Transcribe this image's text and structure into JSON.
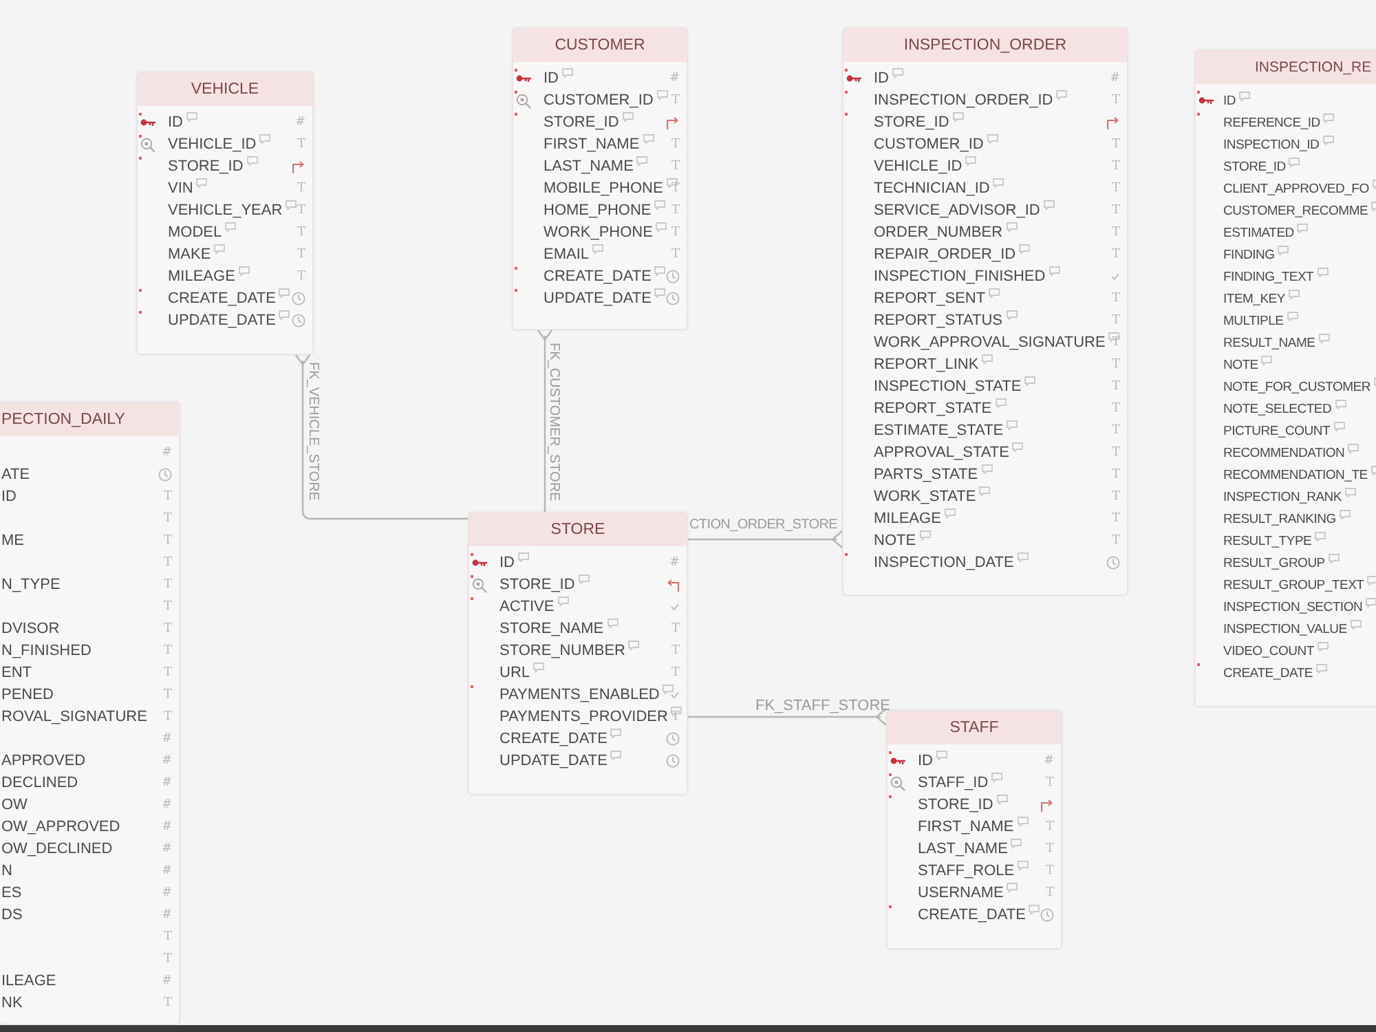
{
  "tables": [
    {
      "title": "CUSTOMER",
      "comments": true,
      "columns": [
        {
          "name": "ID",
          "kind": "number",
          "type_icon": "#",
          "primary_key": true,
          "unique": false,
          "required": true
        },
        {
          "name": "CUSTOMER_ID",
          "kind": "text",
          "type_icon": "T",
          "primary_key": false,
          "unique": true,
          "required": true
        },
        {
          "name": "STORE_ID",
          "kind": "foreign",
          "primary_key": false,
          "unique": false,
          "required": true
        },
        {
          "name": "FIRST_NAME",
          "kind": "text",
          "type_icon": "T",
          "primary_key": false,
          "unique": false,
          "required": false
        },
        {
          "name": "LAST_NAME",
          "kind": "text",
          "type_icon": "T",
          "primary_key": false,
          "unique": false,
          "required": false
        },
        {
          "name": "MOBILE_PHONE",
          "kind": "text",
          "type_icon": "T",
          "primary_key": false,
          "unique": false,
          "required": false
        },
        {
          "name": "HOME_PHONE",
          "kind": "text",
          "type_icon": "T",
          "primary_key": false,
          "unique": false,
          "required": false
        },
        {
          "name": "WORK_PHONE",
          "kind": "text",
          "type_icon": "T",
          "primary_key": false,
          "unique": false,
          "required": false
        },
        {
          "name": "EMAIL",
          "kind": "text",
          "type_icon": "T",
          "primary_key": false,
          "unique": false,
          "required": false
        },
        {
          "name": "CREATE_DATE",
          "kind": "date",
          "primary_key": false,
          "unique": false,
          "required": true
        },
        {
          "name": "UPDATE_DATE",
          "kind": "date",
          "primary_key": false,
          "unique": false,
          "required": true
        }
      ]
    },
    {
      "title": "INSPECTION_ORDER",
      "comments": true,
      "columns": [
        {
          "name": "ID",
          "kind": "number",
          "type_icon": "#",
          "primary_key": true,
          "unique": false,
          "required": true
        },
        {
          "name": "INSPECTION_ORDER_ID",
          "kind": "text",
          "type_icon": "T",
          "primary_key": false,
          "unique": false,
          "required": true
        },
        {
          "name": "STORE_ID",
          "kind": "foreign",
          "primary_key": false,
          "unique": false,
          "required": true
        },
        {
          "name": "CUSTOMER_ID",
          "kind": "text",
          "type_icon": "T",
          "primary_key": false,
          "unique": false,
          "required": false
        },
        {
          "name": "VEHICLE_ID",
          "kind": "text",
          "type_icon": "T",
          "primary_key": false,
          "unique": false,
          "required": false
        },
        {
          "name": "TECHNICIAN_ID",
          "kind": "text",
          "type_icon": "T",
          "primary_key": false,
          "unique": false,
          "required": false
        },
        {
          "name": "SERVICE_ADVISOR_ID",
          "kind": "text",
          "type_icon": "T",
          "primary_key": false,
          "unique": false,
          "required": false
        },
        {
          "name": "ORDER_NUMBER",
          "kind": "text",
          "type_icon": "T",
          "primary_key": false,
          "unique": false,
          "required": false
        },
        {
          "name": "REPAIR_ORDER_ID",
          "kind": "text",
          "type_icon": "T",
          "primary_key": false,
          "unique": false,
          "required": false
        },
        {
          "name": "INSPECTION_FINISHED",
          "kind": "boolean",
          "primary_key": false,
          "unique": false,
          "required": false
        },
        {
          "name": "REPORT_SENT",
          "kind": "text",
          "type_icon": "T",
          "primary_key": false,
          "unique": false,
          "required": false
        },
        {
          "name": "REPORT_STATUS",
          "kind": "text",
          "type_icon": "T",
          "primary_key": false,
          "unique": false,
          "required": false
        },
        {
          "name": "WORK_APPROVAL_SIGNATURE",
          "kind": "text",
          "type_icon": "T",
          "primary_key": false,
          "unique": false,
          "required": false
        },
        {
          "name": "REPORT_LINK",
          "kind": "text",
          "type_icon": "T",
          "primary_key": false,
          "unique": false,
          "required": false
        },
        {
          "name": "INSPECTION_STATE",
          "kind": "text",
          "type_icon": "T",
          "primary_key": false,
          "unique": false,
          "required": false
        },
        {
          "name": "REPORT_STATE",
          "kind": "text",
          "type_icon": "T",
          "primary_key": false,
          "unique": false,
          "required": false
        },
        {
          "name": "ESTIMATE_STATE",
          "kind": "text",
          "type_icon": "T",
          "primary_key": false,
          "unique": false,
          "required": false
        },
        {
          "name": "APPROVAL_STATE",
          "kind": "text",
          "type_icon": "T",
          "primary_key": false,
          "unique": false,
          "required": false
        },
        {
          "name": "PARTS_STATE",
          "kind": "text",
          "type_icon": "T",
          "primary_key": false,
          "unique": false,
          "required": false
        },
        {
          "name": "WORK_STATE",
          "kind": "text",
          "type_icon": "T",
          "primary_key": false,
          "unique": false,
          "required": false
        },
        {
          "name": "MILEAGE",
          "kind": "text",
          "type_icon": "T",
          "primary_key": false,
          "unique": false,
          "required": false
        },
        {
          "name": "NOTE",
          "kind": "text",
          "type_icon": "T",
          "primary_key": false,
          "unique": false,
          "required": false
        },
        {
          "name": "INSPECTION_DATE",
          "kind": "date",
          "primary_key": false,
          "unique": false,
          "required": true
        }
      ]
    },
    {
      "title": "INSPECTION_RE",
      "comments": true,
      "columns": [
        {
          "name": "ID",
          "kind": "plain",
          "primary_key": true,
          "unique": false,
          "required": true
        },
        {
          "name": "REFERENCE_ID",
          "kind": "plain",
          "primary_key": false,
          "unique": false,
          "required": true
        },
        {
          "name": "INSPECTION_ID",
          "kind": "plain",
          "primary_key": false,
          "unique": false,
          "required": false
        },
        {
          "name": "STORE_ID",
          "kind": "plain",
          "primary_key": false,
          "unique": false,
          "required": false
        },
        {
          "name": "CLIENT_APPROVED_FO",
          "kind": "plain",
          "primary_key": false,
          "unique": false,
          "required": false
        },
        {
          "name": "CUSTOMER_RECOMME",
          "kind": "plain",
          "primary_key": false,
          "unique": false,
          "required": false
        },
        {
          "name": "ESTIMATED",
          "kind": "plain",
          "primary_key": false,
          "unique": false,
          "required": false
        },
        {
          "name": "FINDING",
          "kind": "plain",
          "primary_key": false,
          "unique": false,
          "required": false
        },
        {
          "name": "FINDING_TEXT",
          "kind": "plain",
          "primary_key": false,
          "unique": false,
          "required": false
        },
        {
          "name": "ITEM_KEY",
          "kind": "plain",
          "primary_key": false,
          "unique": false,
          "required": false
        },
        {
          "name": "MULTIPLE",
          "kind": "plain",
          "primary_key": false,
          "unique": false,
          "required": false
        },
        {
          "name": "RESULT_NAME",
          "kind": "plain",
          "primary_key": false,
          "unique": false,
          "required": false
        },
        {
          "name": "NOTE",
          "kind": "plain",
          "primary_key": false,
          "unique": false,
          "required": false
        },
        {
          "name": "NOTE_FOR_CUSTOMER",
          "kind": "plain",
          "primary_key": false,
          "unique": false,
          "required": false
        },
        {
          "name": "NOTE_SELECTED",
          "kind": "plain",
          "primary_key": false,
          "unique": false,
          "required": false
        },
        {
          "name": "PICTURE_COUNT",
          "kind": "plain",
          "primary_key": false,
          "unique": false,
          "required": false
        },
        {
          "name": "RECOMMENDATION",
          "kind": "plain",
          "primary_key": false,
          "unique": false,
          "required": false
        },
        {
          "name": "RECOMMENDATION_TE",
          "kind": "plain",
          "primary_key": false,
          "unique": false,
          "required": false
        },
        {
          "name": "INSPECTION_RANK",
          "kind": "plain",
          "primary_key": false,
          "unique": false,
          "required": false
        },
        {
          "name": "RESULT_RANKING",
          "kind": "plain",
          "primary_key": false,
          "unique": false,
          "required": false
        },
        {
          "name": "RESULT_TYPE",
          "kind": "plain",
          "primary_key": false,
          "unique": false,
          "required": false
        },
        {
          "name": "RESULT_GROUP",
          "kind": "plain",
          "primary_key": false,
          "unique": false,
          "required": false
        },
        {
          "name": "RESULT_GROUP_TEXT",
          "kind": "plain",
          "primary_key": false,
          "unique": false,
          "required": false
        },
        {
          "name": "INSPECTION_SECTION",
          "kind": "plain",
          "primary_key": false,
          "unique": false,
          "required": false
        },
        {
          "name": "INSPECTION_VALUE",
          "kind": "plain",
          "primary_key": false,
          "unique": false,
          "required": false
        },
        {
          "name": "VIDEO_COUNT",
          "kind": "plain",
          "primary_key": false,
          "unique": false,
          "required": false
        },
        {
          "name": "CREATE_DATE",
          "kind": "plain",
          "primary_key": false,
          "unique": false,
          "required": true
        }
      ]
    },
    {
      "title": "VEHICLE",
      "comments": true,
      "columns": [
        {
          "name": "ID",
          "kind": "number",
          "type_icon": "#",
          "primary_key": true,
          "unique": false,
          "required": true
        },
        {
          "name": "VEHICLE_ID",
          "kind": "text",
          "type_icon": "T",
          "primary_key": false,
          "unique": true,
          "required": true
        },
        {
          "name": "STORE_ID",
          "kind": "foreign",
          "primary_key": false,
          "unique": false,
          "required": true
        },
        {
          "name": "VIN",
          "kind": "text",
          "type_icon": "T",
          "primary_key": false,
          "unique": false,
          "required": false
        },
        {
          "name": "VEHICLE_YEAR",
          "kind": "text",
          "type_icon": "T",
          "primary_key": false,
          "unique": false,
          "required": false
        },
        {
          "name": "MODEL",
          "kind": "text",
          "type_icon": "T",
          "primary_key": false,
          "unique": false,
          "required": false
        },
        {
          "name": "MAKE",
          "kind": "text",
          "type_icon": "T",
          "primary_key": false,
          "unique": false,
          "required": false
        },
        {
          "name": "MILEAGE",
          "kind": "text",
          "type_icon": "T",
          "primary_key": false,
          "unique": false,
          "required": false
        },
        {
          "name": "CREATE_DATE",
          "kind": "date",
          "primary_key": false,
          "unique": false,
          "required": true
        },
        {
          "name": "UPDATE_DATE",
          "kind": "date",
          "primary_key": false,
          "unique": false,
          "required": true
        }
      ]
    },
    {
      "title": "PECTION_DAILY",
      "comments": false,
      "columns": [
        {
          "kind": "number",
          "type_icon": "#",
          "primary_key": false,
          "unique": false,
          "required": false
        },
        {
          "name": "ATE",
          "kind": "date",
          "primary_key": false,
          "unique": false,
          "required": false
        },
        {
          "name": "ID",
          "kind": "text",
          "type_icon": "T",
          "primary_key": false,
          "unique": false,
          "required": false
        },
        {
          "kind": "text",
          "type_icon": "T",
          "primary_key": false,
          "unique": false,
          "required": false
        },
        {
          "name": "ME",
          "kind": "text",
          "type_icon": "T",
          "primary_key": false,
          "unique": false,
          "required": false
        },
        {
          "kind": "text",
          "type_icon": "T",
          "primary_key": false,
          "unique": false,
          "required": false
        },
        {
          "name": "N_TYPE",
          "kind": "text",
          "type_icon": "T",
          "primary_key": false,
          "unique": false,
          "required": false
        },
        {
          "kind": "text",
          "type_icon": "T",
          "primary_key": false,
          "unique": false,
          "required": false
        },
        {
          "name": "DVISOR",
          "kind": "text",
          "type_icon": "T",
          "primary_key": false,
          "unique": false,
          "required": false
        },
        {
          "name": "N_FINISHED",
          "kind": "text",
          "type_icon": "T",
          "primary_key": false,
          "unique": false,
          "required": false
        },
        {
          "name": "ENT",
          "kind": "text",
          "type_icon": "T",
          "primary_key": false,
          "unique": false,
          "required": false
        },
        {
          "name": "PENED",
          "kind": "text",
          "type_icon": "T",
          "primary_key": false,
          "unique": false,
          "required": false
        },
        {
          "name": "ROVAL_SIGNATURE",
          "kind": "text",
          "type_icon": "T",
          "primary_key": false,
          "unique": false,
          "required": false
        },
        {
          "kind": "number",
          "type_icon": "#",
          "primary_key": false,
          "unique": false,
          "required": false
        },
        {
          "name": "APPROVED",
          "kind": "number",
          "type_icon": "#",
          "primary_key": false,
          "unique": false,
          "required": false
        },
        {
          "name": "DECLINED",
          "kind": "number",
          "type_icon": "#",
          "primary_key": false,
          "unique": false,
          "required": false
        },
        {
          "name": "OW",
          "kind": "number",
          "type_icon": "#",
          "primary_key": false,
          "unique": false,
          "required": false
        },
        {
          "name": "OW_APPROVED",
          "kind": "number",
          "type_icon": "#",
          "primary_key": false,
          "unique": false,
          "required": false
        },
        {
          "name": "OW_DECLINED",
          "kind": "number",
          "type_icon": "#",
          "primary_key": false,
          "unique": false,
          "required": false
        },
        {
          "name": "N",
          "kind": "number",
          "type_icon": "#",
          "primary_key": false,
          "unique": false,
          "required": false
        },
        {
          "name": "ES",
          "kind": "number",
          "type_icon": "#",
          "primary_key": false,
          "unique": false,
          "required": false
        },
        {
          "name": "DS",
          "kind": "number",
          "type_icon": "#",
          "primary_key": false,
          "unique": false,
          "required": false
        },
        {
          "kind": "text",
          "type_icon": "T",
          "primary_key": false,
          "unique": false,
          "required": false
        },
        {
          "kind": "text",
          "type_icon": "T",
          "primary_key": false,
          "unique": false,
          "required": false
        },
        {
          "name": "ILEAGE",
          "kind": "number",
          "type_icon": "#",
          "primary_key": false,
          "unique": false,
          "required": false
        },
        {
          "name": "NK",
          "kind": "text",
          "type_icon": "T",
          "primary_key": false,
          "unique": false,
          "required": false
        }
      ]
    },
    {
      "title": "STORE",
      "comments": true,
      "columns": [
        {
          "name": "ID",
          "kind": "number",
          "type_icon": "#",
          "primary_key": true,
          "unique": false,
          "required": true
        },
        {
          "name": "STORE_ID",
          "kind": "referenced",
          "primary_key": false,
          "unique": true,
          "required": true
        },
        {
          "name": "ACTIVE",
          "kind": "boolean",
          "primary_key": false,
          "unique": false,
          "required": true
        },
        {
          "name": "STORE_NAME",
          "kind": "text",
          "type_icon": "T",
          "primary_key": false,
          "unique": false,
          "required": false
        },
        {
          "name": "STORE_NUMBER",
          "kind": "text",
          "type_icon": "T",
          "primary_key": false,
          "unique": false,
          "required": false
        },
        {
          "name": "URL",
          "kind": "text",
          "type_icon": "T",
          "primary_key": false,
          "unique": false,
          "required": false
        },
        {
          "name": "PAYMENTS_ENABLED",
          "kind": "boolean",
          "primary_key": false,
          "unique": false,
          "required": true
        },
        {
          "name": "PAYMENTS_PROVIDER",
          "kind": "text",
          "type_icon": "T",
          "primary_key": false,
          "unique": false,
          "required": false
        },
        {
          "name": "CREATE_DATE",
          "kind": "date",
          "primary_key": false,
          "unique": false,
          "required": false
        },
        {
          "name": "UPDATE_DATE",
          "kind": "date",
          "primary_key": false,
          "unique": false,
          "required": false
        }
      ]
    },
    {
      "title": "STAFF",
      "comments": true,
      "columns": [
        {
          "name": "ID",
          "kind": "number",
          "type_icon": "#",
          "primary_key": true,
          "unique": false,
          "required": true
        },
        {
          "name": "STAFF_ID",
          "kind": "text",
          "type_icon": "T",
          "primary_key": false,
          "unique": true,
          "required": true
        },
        {
          "name": "STORE_ID",
          "kind": "foreign",
          "primary_key": false,
          "unique": false,
          "required": true
        },
        {
          "name": "FIRST_NAME",
          "kind": "text",
          "type_icon": "T",
          "primary_key": false,
          "unique": false,
          "required": false
        },
        {
          "name": "LAST_NAME",
          "kind": "text",
          "type_icon": "T",
          "primary_key": false,
          "unique": false,
          "required": false
        },
        {
          "name": "STAFF_ROLE",
          "kind": "text",
          "type_icon": "T",
          "primary_key": false,
          "unique": false,
          "required": false
        },
        {
          "name": "USERNAME",
          "kind": "text",
          "type_icon": "T",
          "primary_key": false,
          "unique": false,
          "required": false
        },
        {
          "name": "CREATE_DATE",
          "kind": "date",
          "primary_key": false,
          "unique": false,
          "required": true
        }
      ]
    }
  ],
  "relations": [
    {
      "label": "FK_VEHICLE_STORE"
    },
    {
      "label": "FK_CUSTOMER_STORE"
    },
    {
      "label": "CTION_ORDER_STORE"
    },
    {
      "label": "FK_STAFF_STORE"
    }
  ]
}
